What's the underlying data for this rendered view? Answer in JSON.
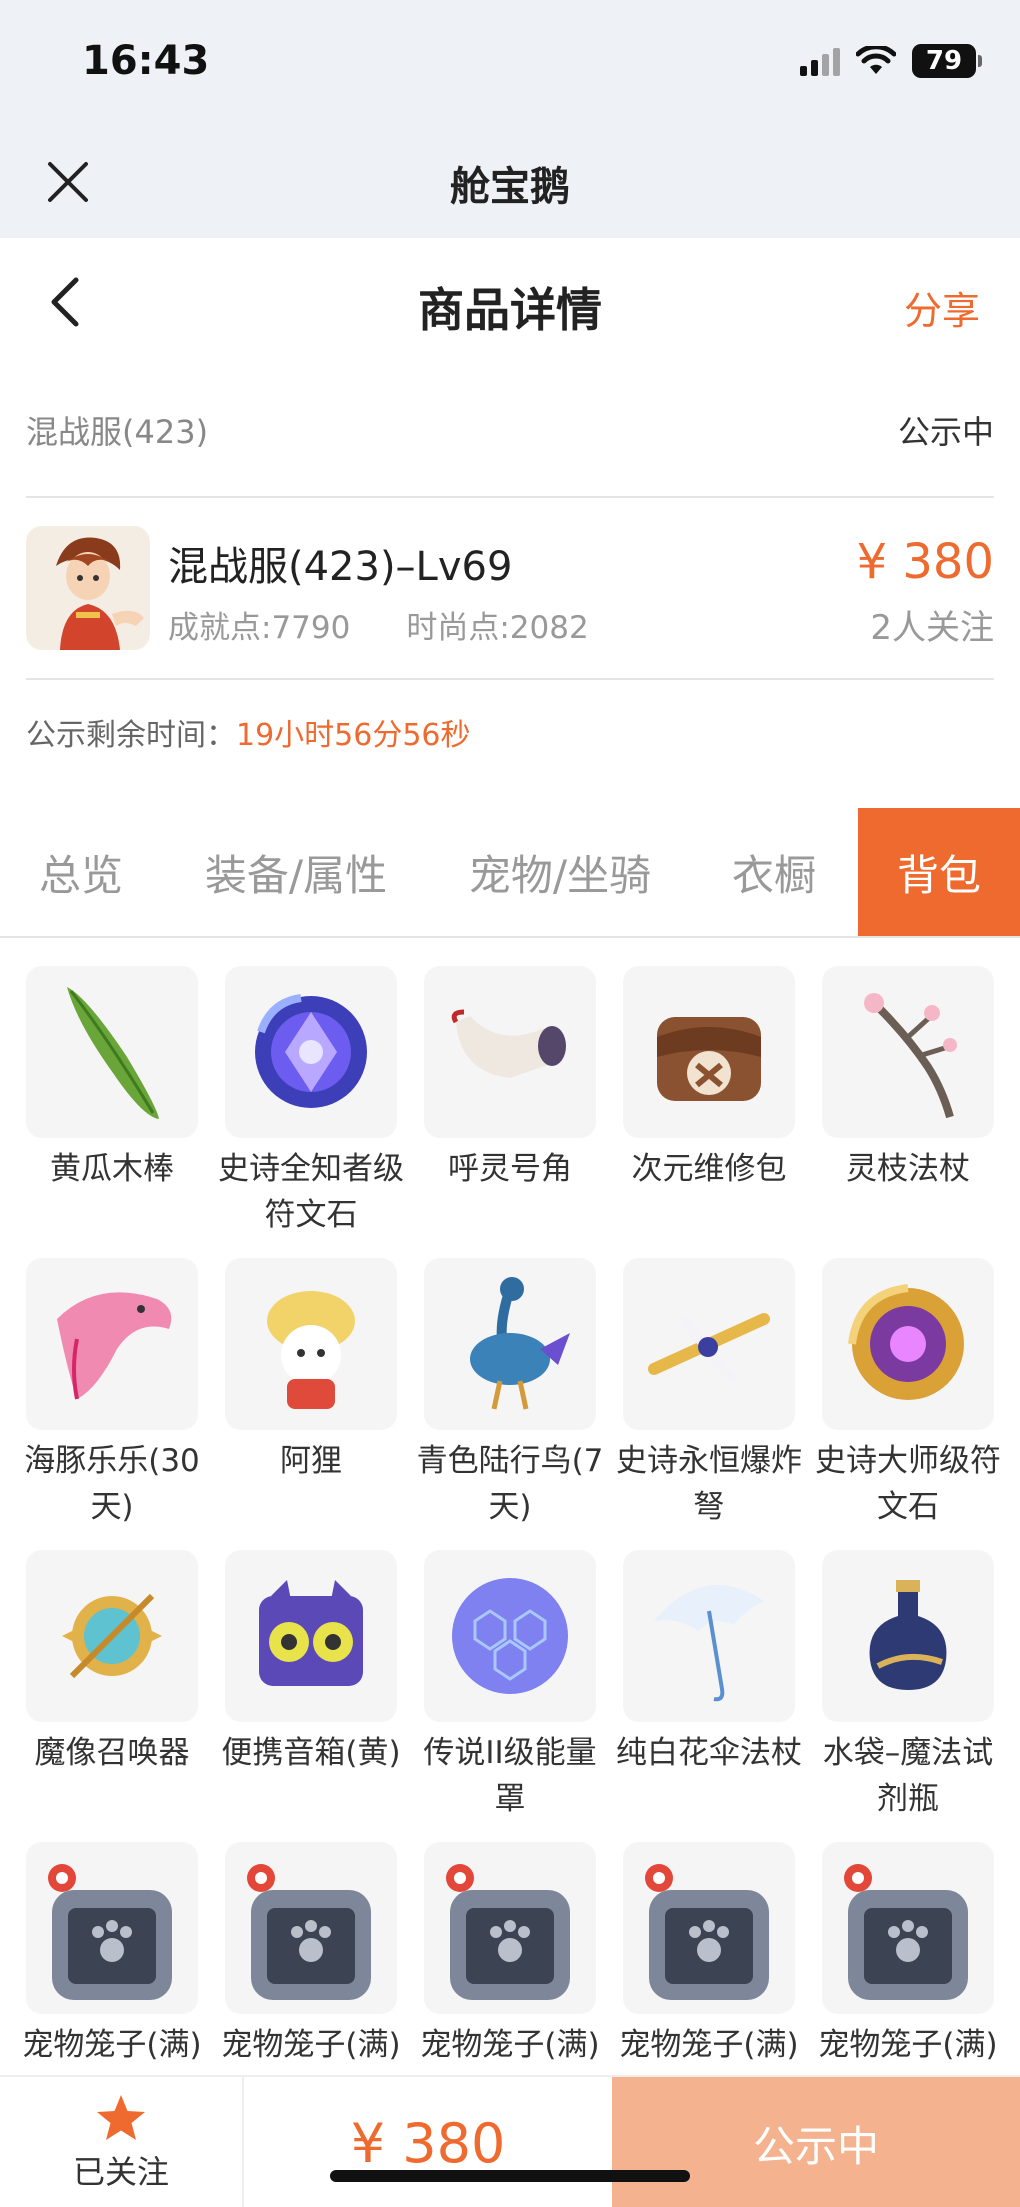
{
  "status_bar": {
    "time": "16:43",
    "battery": "79"
  },
  "app": {
    "title": "舱宝鹅"
  },
  "nav": {
    "title": "商品详情",
    "share": "分享"
  },
  "server": {
    "name": "混战服(423)",
    "status": "公示中"
  },
  "product": {
    "title": "混战服(423)–Lv69",
    "achievement": "成就点:7790",
    "fashion": "时尚点:2082",
    "price": "¥ 380",
    "follows": "2人关注"
  },
  "countdown": {
    "label": "公示剩余时间：",
    "time": "19小时56分56秒"
  },
  "tabs": [
    {
      "label": "总览"
    },
    {
      "label": "装备/属性"
    },
    {
      "label": "宠物/坐骑"
    },
    {
      "label": "衣橱"
    },
    {
      "label": "背包",
      "active": true
    }
  ],
  "items": [
    {
      "name": "黄瓜木棒",
      "icon": "cucumber-stick-icon"
    },
    {
      "name": "史诗全知者级符文石",
      "icon": "epic-rune-stone-icon"
    },
    {
      "name": "呼灵号角",
      "icon": "horn-icon"
    },
    {
      "name": "次元维修包",
      "icon": "repair-bag-icon"
    },
    {
      "name": "灵枝法杖",
      "icon": "branch-staff-icon"
    },
    {
      "name": "海豚乐乐(30天)",
      "icon": "pink-dolphin-icon"
    },
    {
      "name": "阿狸",
      "icon": "ali-fox-icon"
    },
    {
      "name": "青色陆行鸟(7天)",
      "icon": "blue-bird-icon"
    },
    {
      "name": "史诗永恒爆炸弩",
      "icon": "crossbow-icon"
    },
    {
      "name": "史诗大师级符文石",
      "icon": "master-rune-stone-icon"
    },
    {
      "name": "魔像召唤器",
      "icon": "golem-summoner-icon"
    },
    {
      "name": "便携音箱(黄)",
      "icon": "speaker-icon"
    },
    {
      "name": "传说II级能量罩",
      "icon": "energy-shield-icon"
    },
    {
      "name": "纯白花伞法杖",
      "icon": "umbrella-staff-icon"
    },
    {
      "name": "水袋–魔法试剂瓶",
      "icon": "potion-bottle-icon"
    },
    {
      "name": "宠物笼子(满)",
      "icon": "pet-cage-icon"
    },
    {
      "name": "宠物笼子(满)",
      "icon": "pet-cage-icon"
    },
    {
      "name": "宠物笼子(满)",
      "icon": "pet-cage-icon"
    },
    {
      "name": "宠物笼子(满)",
      "icon": "pet-cage-icon"
    },
    {
      "name": "宠物笼子(满)",
      "icon": "pet-cage-icon"
    }
  ],
  "bottom": {
    "follow_label": "已关注",
    "price": "¥ 380",
    "action": "公示中"
  },
  "colors": {
    "accent": "#ee6a2f",
    "action_bg": "#f4b28e",
    "header_bg": "#eef1f5"
  }
}
